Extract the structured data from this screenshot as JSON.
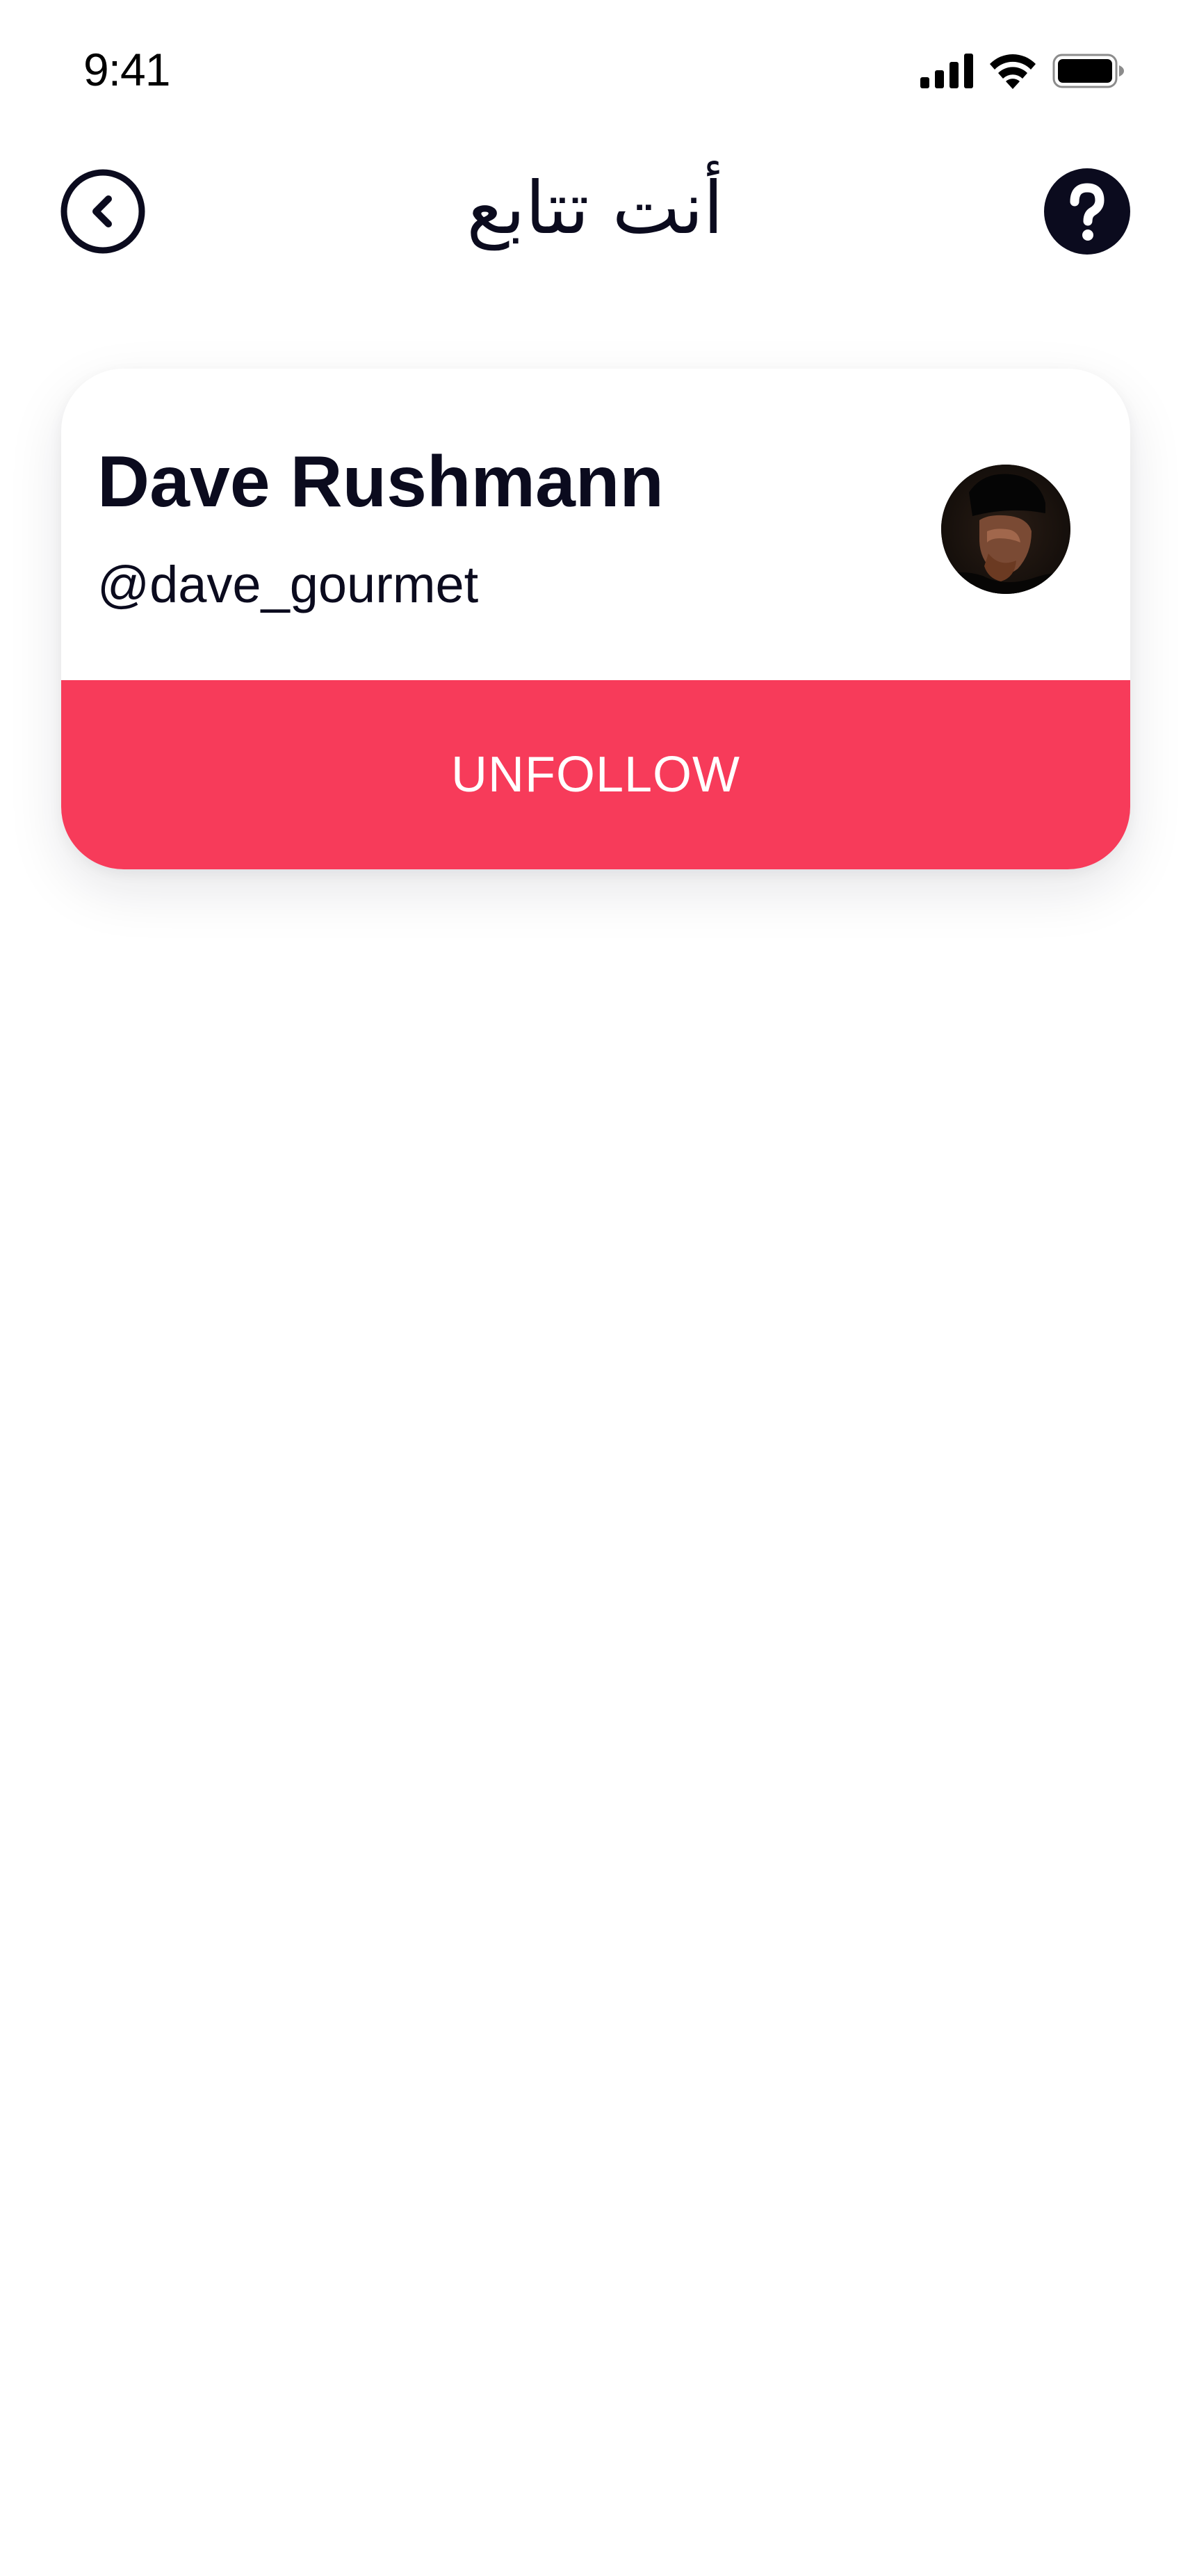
{
  "status_bar": {
    "time": "9:41",
    "icons": [
      "cellular-signal-icon",
      "wifi-icon",
      "battery-icon"
    ]
  },
  "header": {
    "title": "أنت تتابع",
    "back_icon": "chevron-left-circle-icon",
    "help_icon": "question-circle-icon"
  },
  "following": [
    {
      "name": "Dave Rushmann",
      "handle": "@dave_gourmet",
      "avatar": "avatar-photo",
      "action_label": "UNFOLLOW"
    }
  ],
  "colors": {
    "accent": "#f73b5a",
    "text": "#0b0b1e",
    "background": "#ffffff"
  }
}
